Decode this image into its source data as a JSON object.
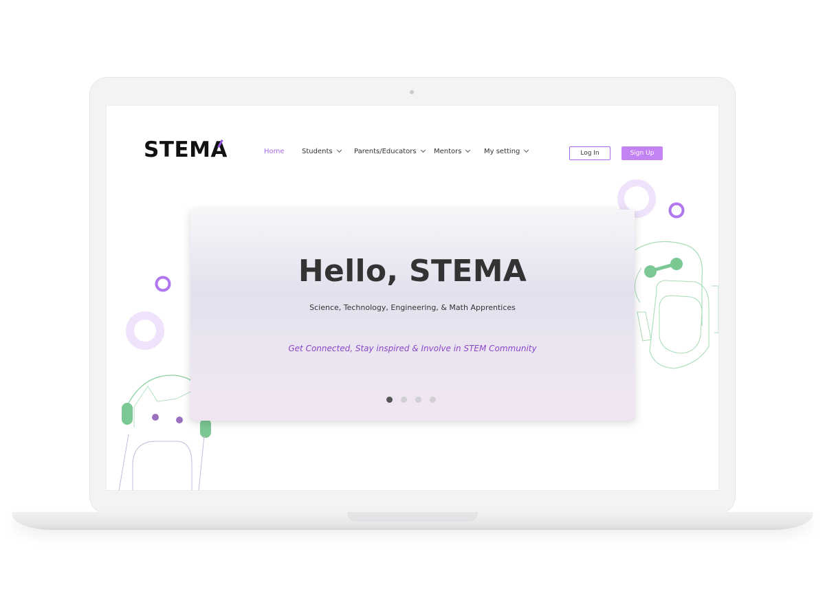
{
  "brand": {
    "logo_text": "STEMA"
  },
  "nav": {
    "items": [
      {
        "label": "Home",
        "active": true,
        "has_dropdown": false
      },
      {
        "label": "Students",
        "active": false,
        "has_dropdown": true
      },
      {
        "label": "Parents/Educators",
        "active": false,
        "has_dropdown": true
      },
      {
        "label": "Mentors",
        "active": false,
        "has_dropdown": true
      },
      {
        "label": "My setting",
        "active": false,
        "has_dropdown": true
      }
    ]
  },
  "auth": {
    "login_label": "Log In",
    "signup_label": "Sign Up"
  },
  "hero": {
    "title": "Hello, STEMA",
    "subtitle": "Science, Technology, Engineering, & Math Apprentices",
    "tagline": "Get Connected, Stay inspired & Involve in STEM Community",
    "slide_count": 4,
    "active_slide": 1
  },
  "colors": {
    "accent": "#a569ea",
    "signup_bg": "#c383f2",
    "tagline": "#8a47c9",
    "robot_green": "#7cc894",
    "ring_light": "#ecdffb"
  },
  "icons": {
    "robot_left": "robot-illustration",
    "robot_right": "robot-illustration",
    "chevron": "chevron-down-icon"
  }
}
